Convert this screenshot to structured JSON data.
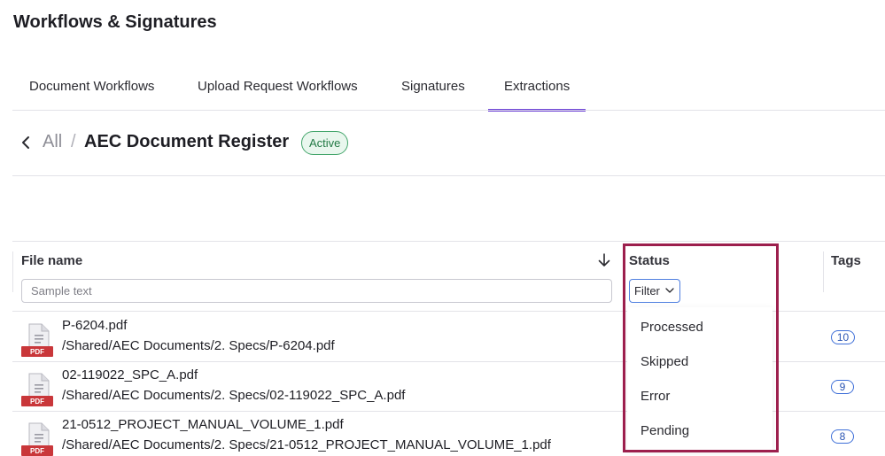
{
  "page": {
    "title": "Workflows & Signatures"
  },
  "tabs": [
    {
      "label": "Document Workflows"
    },
    {
      "label": "Upload Request Workflows"
    },
    {
      "label": "Signatures"
    },
    {
      "label": "Extractions"
    }
  ],
  "breadcrumb": {
    "all_label": "All",
    "separator": "/",
    "title": "AEC Document Register",
    "status_badge": "Active"
  },
  "table": {
    "headers": {
      "file_name": "File name",
      "status": "Status",
      "tags": "Tags"
    },
    "search_placeholder": "Sample text",
    "status_filter_label": "Filter",
    "rows": [
      {
        "file_icon_label": "PDF",
        "name": "P-6204.pdf",
        "path": "/Shared/AEC Documents/2. Specs/P-6204.pdf",
        "tags": "10"
      },
      {
        "file_icon_label": "PDF",
        "name": "02-119022_SPC_A.pdf",
        "path": "/Shared/AEC Documents/2. Specs/02-119022_SPC_A.pdf",
        "tags": "9"
      },
      {
        "file_icon_label": "PDF",
        "name": "21-0512_PROJECT_MANUAL_VOLUME_1.pdf",
        "path": "/Shared/AEC Documents/2. Specs/21-0512_PROJECT_MANUAL_VOLUME_1.pdf",
        "tags": "8"
      }
    ]
  },
  "status_dropdown": {
    "options": [
      "Processed",
      "Skipped",
      "Error",
      "Pending"
    ]
  },
  "colors": {
    "tab_active_underline": "#6b3fd6",
    "badge_green": "#43a56b",
    "filter_border": "#4f7fe0",
    "highlight_border": "#9c1f4d",
    "pdf_red": "#c9373a"
  },
  "icons": {
    "back": "chevron-left-icon",
    "sort": "arrow-down-icon",
    "filter_chevron": "chevron-down-icon",
    "file": "pdf-file-icon"
  }
}
